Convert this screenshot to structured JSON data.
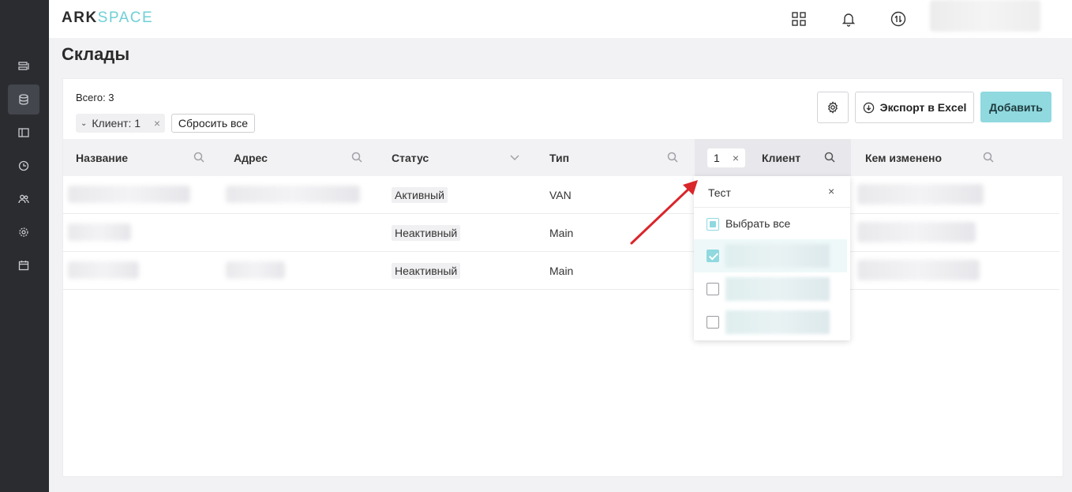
{
  "app": {
    "logo_part1": "ARK",
    "logo_part2": "SPACE",
    "page_title": "Склады"
  },
  "sidebar": {
    "items": [
      {
        "icon": "list-icon",
        "active": false
      },
      {
        "icon": "database-icon",
        "active": true
      },
      {
        "icon": "layout-icon",
        "active": false
      },
      {
        "icon": "clock-icon",
        "active": false
      },
      {
        "icon": "users-icon",
        "active": false
      },
      {
        "icon": "gear-icon",
        "active": false
      },
      {
        "icon": "calendar-icon",
        "active": false
      }
    ]
  },
  "toolbar": {
    "total": "Всего: 3",
    "filter_chip": "Клиент: 1",
    "reset_label": "Сбросить все",
    "export_label": "Экспорт в Excel",
    "add_label": "Добавить"
  },
  "table": {
    "columns": [
      "Название",
      "Адрес",
      "Статус",
      "Тип",
      "Клиент",
      "Кем изменено"
    ],
    "client_filter_count": "1",
    "rows": [
      {
        "status": "Активный",
        "type": "VAN"
      },
      {
        "status": "Неактивный",
        "type": "Main"
      },
      {
        "status": "Неактивный",
        "type": "Main"
      }
    ]
  },
  "dropdown": {
    "search_value": "Тест",
    "select_all": "Выбрать все",
    "options": [
      {
        "checked": true
      },
      {
        "checked": false
      },
      {
        "checked": false
      }
    ]
  },
  "colors": {
    "accent": "#8fd9df",
    "sidebar": "#2a2c30",
    "arrow": "#d9262b"
  }
}
